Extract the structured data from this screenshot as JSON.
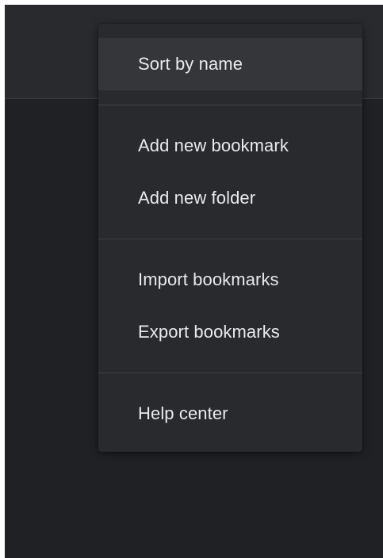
{
  "menu": {
    "items": [
      {
        "label": "Sort by name"
      },
      {
        "label": "Add new bookmark"
      },
      {
        "label": "Add new folder"
      },
      {
        "label": "Import bookmarks"
      },
      {
        "label": "Export bookmarks"
      },
      {
        "label": "Help center"
      }
    ]
  },
  "colors": {
    "background": "#202124",
    "menu_background": "#292a2d",
    "hover": "#35363a",
    "text": "#e8eaed",
    "divider": "#3c4043"
  }
}
